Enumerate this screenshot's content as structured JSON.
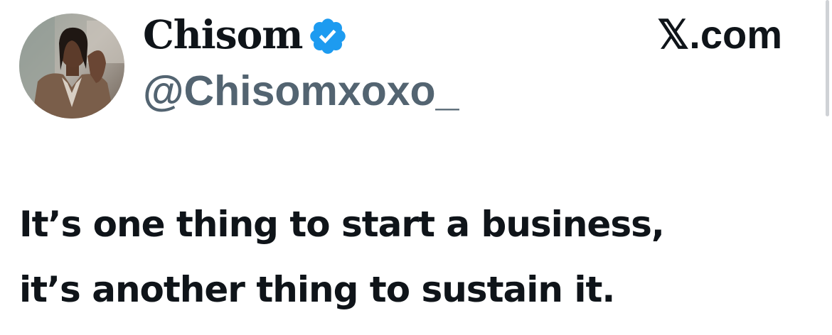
{
  "tweet": {
    "author": {
      "display_name": "Chisom",
      "handle": "@Chisomxoxo_",
      "verified": true,
      "verified_icon": "verified-badge-icon",
      "avatar": "profile-photo"
    },
    "source_label": "𝕏.com",
    "text_lines": [
      "It’s one thing to start a business,",
      "it’s another thing to sustain it."
    ]
  },
  "colors": {
    "text_primary": "#0f1419",
    "text_secondary": "#536471",
    "verified_blue": "#1d9bf0",
    "background": "#ffffff"
  }
}
